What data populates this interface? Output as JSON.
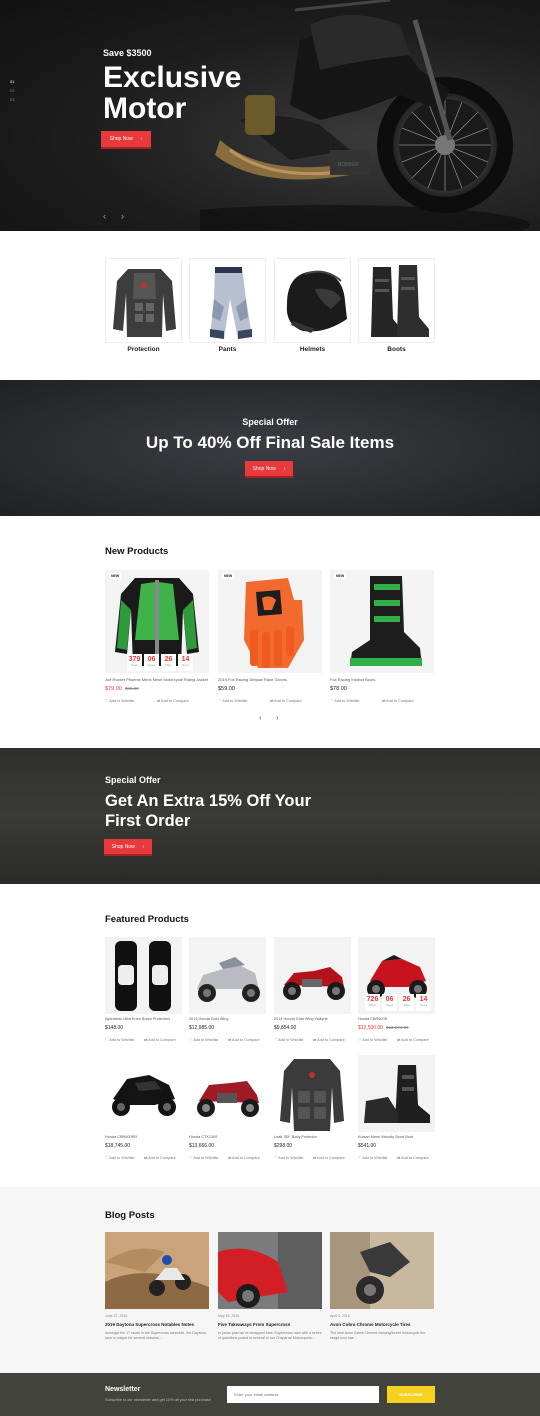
{
  "hero": {
    "kicker": "Save $3500",
    "title_line1": "Exclusive",
    "title_line2": "Motor",
    "button": "Shop Now",
    "slide_dots": [
      "01",
      "02",
      "03"
    ]
  },
  "categories": [
    {
      "label": "Protection"
    },
    {
      "label": "Pants"
    },
    {
      "label": "Helmets"
    },
    {
      "label": "Boots"
    }
  ],
  "banner1": {
    "kicker": "Special Offer",
    "title": "Up To 40% Off Final Sale Items",
    "button": "Shop Now"
  },
  "new_products": {
    "title": "New Products",
    "items": [
      {
        "badge": "NEW",
        "name": "Joe Rocket Phoenix Mens Mesh Motorcycle Riding Jacket",
        "price": "$79.00",
        "old_price": "$99.00",
        "wishlist": "Add to Wishlist",
        "compare": "Add to Compare",
        "countdown": [
          {
            "v": "379",
            "l": "Days"
          },
          {
            "v": "06",
            "l": "Hours"
          },
          {
            "v": "26",
            "l": "Mins"
          },
          {
            "v": "14",
            "l": "Secs"
          }
        ]
      },
      {
        "badge": "NEW",
        "name": "2019 Fox Racing Dirtpaw Race Gloves",
        "price": "$59.00",
        "wishlist": "Add to Wishlist",
        "compare": "Add to Compare"
      },
      {
        "badge": "NEW",
        "name": "Fox Racing Instinct Boots",
        "price": "$78.00",
        "wishlist": "Add to Wishlist",
        "compare": "Add to Compare"
      }
    ]
  },
  "banner2": {
    "kicker": "Special Offer",
    "title_line1": "Get An Extra 15% Off Your",
    "title_line2": "First Order",
    "button": "Shop Now"
  },
  "featured": {
    "title": "Featured Products",
    "items": [
      {
        "name": "Alpinestar Ultra Knee Brace Protectors",
        "price": "$148.00"
      },
      {
        "name": "2019 Honda Gold Wing",
        "price": "$12,985.00"
      },
      {
        "name": "2014 Honda Gold Wing Valkyrie",
        "price": "$9,854.00"
      },
      {
        "name": "Honda CBR600R",
        "price": "$12,500.00",
        "old_price": "$12,874.00",
        "countdown": [
          {
            "v": "726",
            "l": "Days"
          },
          {
            "v": "06",
            "l": "Hours"
          },
          {
            "v": "26",
            "l": "Mins"
          },
          {
            "v": "14",
            "l": "Secs"
          }
        ]
      },
      {
        "name": "Honda CBR600RR",
        "price": "$18,745.00"
      },
      {
        "name": "Honda CTX1300",
        "price": "$13,666.00"
      },
      {
        "name": "Leatt 3DF Body Protector",
        "price": "$298.00"
      },
      {
        "name": "Kulsan Mens Velocity Sport Boot",
        "price": "$541.00"
      }
    ],
    "wishlist": "Add to Wishlist",
    "compare": "Add to Compare"
  },
  "blog": {
    "title": "Blog Posts",
    "posts": [
      {
        "date": "June 22, 2019",
        "title": "2019 Daytona Supercross Notables Notes",
        "excerpt": "Amongst the 17 races in the Supercross schedule, the Daytona race is unique for several reasons..."
      },
      {
        "date": "May 15, 2019",
        "title": "Five Takeaways From Supercross",
        "excerpt": "In years past we've recapped each Supercross race with a series of questions posed to several of our Chaparral Motorsports..."
      },
      {
        "date": "April 8, 2019",
        "title": "Avon Cobra Chrome Motorcycle Tires",
        "excerpt": "The new Avon Cobra Chrome cruising/tourer motorcycle tire range now has..."
      }
    ]
  },
  "newsletter": {
    "title": "Newsletter",
    "subtitle": "Subscribe to our newsletter and get 10% off your first purchase",
    "placeholder": "Enter your email address",
    "button": "SUBSCRIBE"
  },
  "colors": {
    "accent": "#e8393c",
    "subscribe": "#f5d21f",
    "dark": "#1d1d1d"
  }
}
